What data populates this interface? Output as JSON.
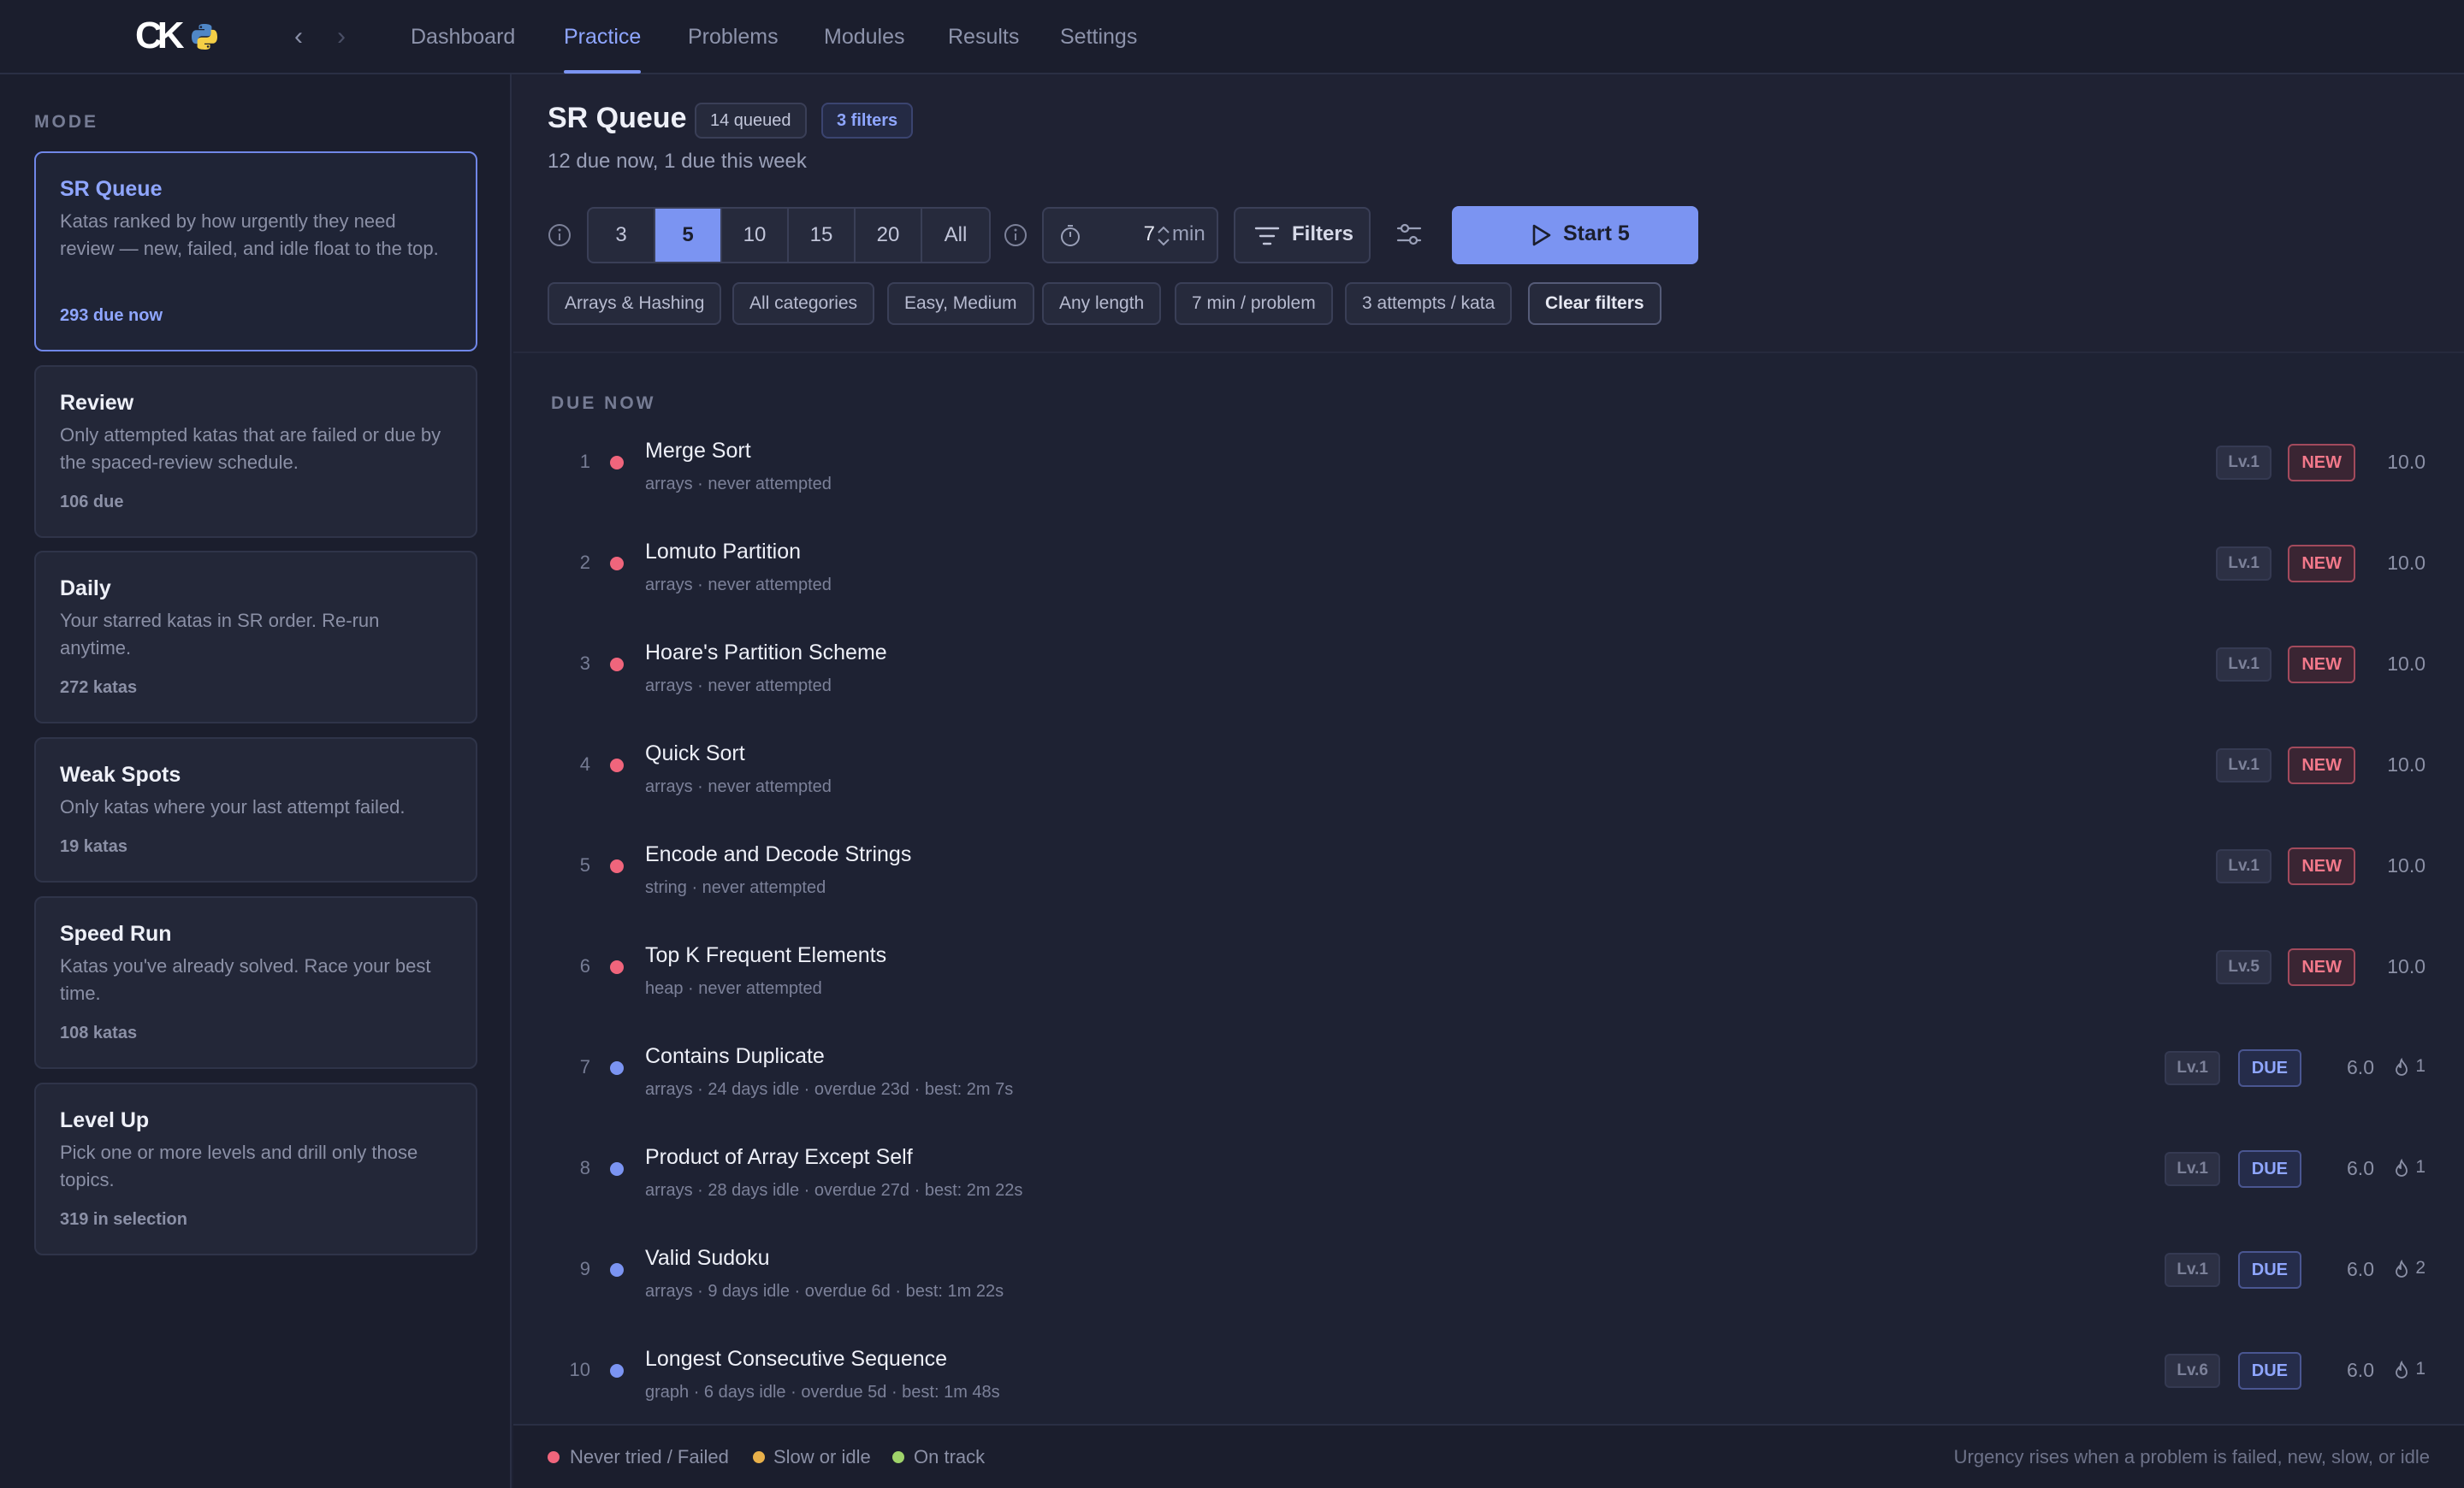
{
  "brand": {
    "logo_text": "CK"
  },
  "nav": {
    "tabs": [
      {
        "label": "Dashboard"
      },
      {
        "label": "Practice"
      },
      {
        "label": "Problems"
      },
      {
        "label": "Modules"
      },
      {
        "label": "Results"
      },
      {
        "label": "Settings"
      }
    ],
    "active_tab": "Practice"
  },
  "sidebar": {
    "heading": "MODE",
    "modes": [
      {
        "title": "SR Queue",
        "desc": "Katas ranked by how urgently they need review — new, failed, and idle float to the top.",
        "count": "293 due now",
        "active": true
      },
      {
        "title": "Review",
        "desc": "Only attempted katas that are failed or due by the spaced-review schedule.",
        "count": "106 due"
      },
      {
        "title": "Daily",
        "desc": "Your starred katas in SR order. Re-run anytime.",
        "count": "272 katas"
      },
      {
        "title": "Weak Spots",
        "desc": "Only katas where your last attempt failed.",
        "count": "19 katas"
      },
      {
        "title": "Speed Run",
        "desc": "Katas you've already solved. Race your best time.",
        "count": "108 katas"
      },
      {
        "title": "Level Up",
        "desc": "Pick one or more levels and drill only those topics.",
        "count": "319 in selection"
      }
    ]
  },
  "header": {
    "title": "SR Queue",
    "queued_pill": "14 queued",
    "filters_pill": "3 filters",
    "subtitle": "12 due now, 1 due this week"
  },
  "controls": {
    "counts": [
      "3",
      "5",
      "10",
      "15",
      "20",
      "All"
    ],
    "selected_count": "5",
    "timer_value": "7",
    "timer_unit": "min",
    "filters_label": "Filters",
    "start_label": "Start 5"
  },
  "chips": [
    "Arrays & Hashing",
    "All categories",
    "Easy, Medium",
    "Any length",
    "7 min / problem",
    "3 attempts / kata"
  ],
  "clear_filters": "Clear filters",
  "list": {
    "section": "DUE NOW",
    "rows": [
      {
        "num": "1",
        "title": "Merge Sort",
        "sub": "arrays · never attempted",
        "level": "Lv.1",
        "status": "NEW",
        "score": "10.0",
        "streak": "",
        "dot": "#f0657c"
      },
      {
        "num": "2",
        "title": "Lomuto Partition",
        "sub": "arrays · never attempted",
        "level": "Lv.1",
        "status": "NEW",
        "score": "10.0",
        "streak": "",
        "dot": "#f0657c"
      },
      {
        "num": "3",
        "title": "Hoare's Partition Scheme",
        "sub": "arrays · never attempted",
        "level": "Lv.1",
        "status": "NEW",
        "score": "10.0",
        "streak": "",
        "dot": "#f0657c"
      },
      {
        "num": "4",
        "title": "Quick Sort",
        "sub": "arrays · never attempted",
        "level": "Lv.1",
        "status": "NEW",
        "score": "10.0",
        "streak": "",
        "dot": "#f0657c"
      },
      {
        "num": "5",
        "title": "Encode and Decode Strings",
        "sub": "string · never attempted",
        "level": "Lv.1",
        "status": "NEW",
        "score": "10.0",
        "streak": "",
        "dot": "#f0657c"
      },
      {
        "num": "6",
        "title": "Top K Frequent Elements",
        "sub": "heap · never attempted",
        "level": "Lv.5",
        "status": "NEW",
        "score": "10.0",
        "streak": "",
        "dot": "#f0657c"
      },
      {
        "num": "7",
        "title": "Contains Duplicate",
        "sub": "arrays · 24 days idle · overdue 23d · best: 2m 7s",
        "level": "Lv.1",
        "status": "DUE",
        "score": "6.0",
        "streak": "1",
        "dot": "#7b94f2"
      },
      {
        "num": "8",
        "title": "Product of Array Except Self",
        "sub": "arrays · 28 days idle · overdue 27d · best: 2m 22s",
        "level": "Lv.1",
        "status": "DUE",
        "score": "6.0",
        "streak": "1",
        "dot": "#7b94f2"
      },
      {
        "num": "9",
        "title": "Valid Sudoku",
        "sub": "arrays · 9 days idle · overdue 6d · best: 1m 22s",
        "level": "Lv.1",
        "status": "DUE",
        "score": "6.0",
        "streak": "2",
        "dot": "#7b94f2"
      },
      {
        "num": "10",
        "title": "Longest Consecutive Sequence",
        "sub": "graph · 6 days idle · overdue 5d · best: 1m 48s",
        "level": "Lv.6",
        "status": "DUE",
        "score": "6.0",
        "streak": "1",
        "dot": "#7b94f2"
      }
    ]
  },
  "legend": [
    {
      "label": "Never tried / Failed",
      "color": "#f0657c"
    },
    {
      "label": "Slow or idle",
      "color": "#e8b04a"
    },
    {
      "label": "On track",
      "color": "#9fd36a"
    }
  ],
  "footer_note": "Urgency rises when a problem is failed, new, slow, or idle"
}
